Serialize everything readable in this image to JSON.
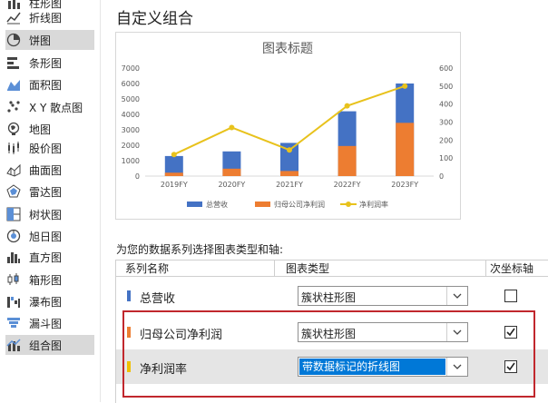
{
  "sidebar": {
    "items": [
      {
        "label": "柱形图",
        "icon": "column-chart-icon"
      },
      {
        "label": "折线图",
        "icon": "line-chart-icon"
      },
      {
        "label": "饼图",
        "icon": "pie-chart-icon",
        "selected": true
      },
      {
        "label": "条形图",
        "icon": "bar-chart-icon"
      },
      {
        "label": "面积图",
        "icon": "area-chart-icon"
      },
      {
        "label": "X Y 散点图",
        "icon": "scatter-chart-icon"
      },
      {
        "label": "地图",
        "icon": "map-chart-icon"
      },
      {
        "label": "股价图",
        "icon": "stock-chart-icon"
      },
      {
        "label": "曲面图",
        "icon": "surface-chart-icon"
      },
      {
        "label": "雷达图",
        "icon": "radar-chart-icon"
      },
      {
        "label": "树状图",
        "icon": "treemap-chart-icon"
      },
      {
        "label": "旭日图",
        "icon": "sunburst-chart-icon"
      },
      {
        "label": "直方图",
        "icon": "histogram-chart-icon"
      },
      {
        "label": "箱形图",
        "icon": "box-whisker-chart-icon"
      },
      {
        "label": "瀑布图",
        "icon": "waterfall-chart-icon"
      },
      {
        "label": "漏斗图",
        "icon": "funnel-chart-icon"
      },
      {
        "label": "组合图",
        "icon": "combo-chart-icon",
        "selected": true
      }
    ]
  },
  "title": "自定义组合",
  "chart_data": {
    "type": "bar",
    "title": "图表标题",
    "categories": [
      "2019FY",
      "2020FY",
      "2021FY",
      "2022FY",
      "2023FY"
    ],
    "y_left_ticks": [
      "0",
      "1000",
      "2000",
      "3000",
      "4000",
      "5000",
      "6000",
      "7000"
    ],
    "y_right_ticks": [
      "0",
      "100",
      "200",
      "300",
      "400",
      "500",
      "600"
    ],
    "ylim": [
      0,
      7000
    ],
    "y2lim": [
      0,
      600
    ],
    "stacked": true,
    "series": [
      {
        "name": "总营收",
        "kind": "bar",
        "color": "#4472c4",
        "values": [
          1300,
          1600,
          2150,
          4200,
          6000
        ]
      },
      {
        "name": "归母公司净利润",
        "kind": "bar",
        "color": "#ed7d31",
        "values": [
          220,
          480,
          330,
          1950,
          3450
        ]
      },
      {
        "name": "净利润率",
        "kind": "line",
        "axis": "secondary",
        "color": "#e8c21c",
        "values": [
          120,
          270,
          145,
          390,
          500
        ]
      }
    ],
    "legend_position": "bottom",
    "grid": false
  },
  "instructions": "为您的数据系列选择图表类型和轴:",
  "table": {
    "headers": {
      "name": "系列名称",
      "type": "图表类型",
      "axis": "次坐标轴"
    },
    "rows": [
      {
        "name": "总营收",
        "color": "#4472c4",
        "chart_type": "簇状柱形图",
        "secondary": false,
        "selected": false
      },
      {
        "name": "归母公司净利润",
        "color": "#ed7d31",
        "chart_type": "簇状柱形图",
        "secondary": true,
        "selected": false
      },
      {
        "name": "净利润率",
        "color": "#f0c000",
        "chart_type": "带数据标记的折线图",
        "secondary": true,
        "selected": true
      }
    ]
  },
  "colors": {
    "highlight_box": "#c1272d",
    "selection": "#0078d7"
  }
}
